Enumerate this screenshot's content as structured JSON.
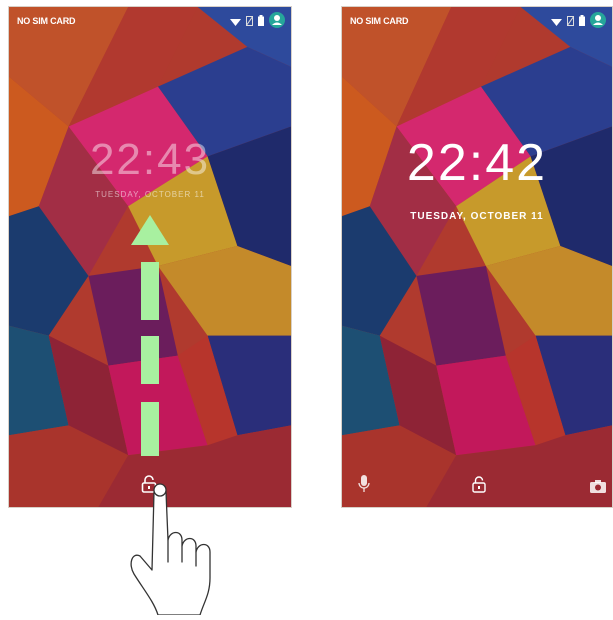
{
  "left_screen": {
    "carrier": "NO SIM CARD",
    "time": "22:43",
    "date": "TUESDAY, OCTOBER 11",
    "icons": [
      "wifi-icon",
      "no-sim-icon",
      "battery-icon",
      "user-icon",
      "lock-open-icon"
    ]
  },
  "right_screen": {
    "carrier": "NO SIM CARD",
    "time": "22:42",
    "date": "TUESDAY, OCTOBER 11",
    "icons": [
      "wifi-icon",
      "no-sim-icon",
      "battery-icon",
      "user-icon",
      "mic-icon",
      "lock-open-icon",
      "camera-icon"
    ]
  },
  "gesture": {
    "type": "swipe-up",
    "arrow_color": "#a8f0a0",
    "hand": "pointing-hand"
  },
  "colors": {
    "accent_teal": "#26a69a",
    "wallpaper": [
      "#c0392b",
      "#d35400",
      "#e91e63",
      "#283593",
      "#1a237e",
      "#b7950b",
      "#4a148c",
      "#0d47a1"
    ]
  }
}
